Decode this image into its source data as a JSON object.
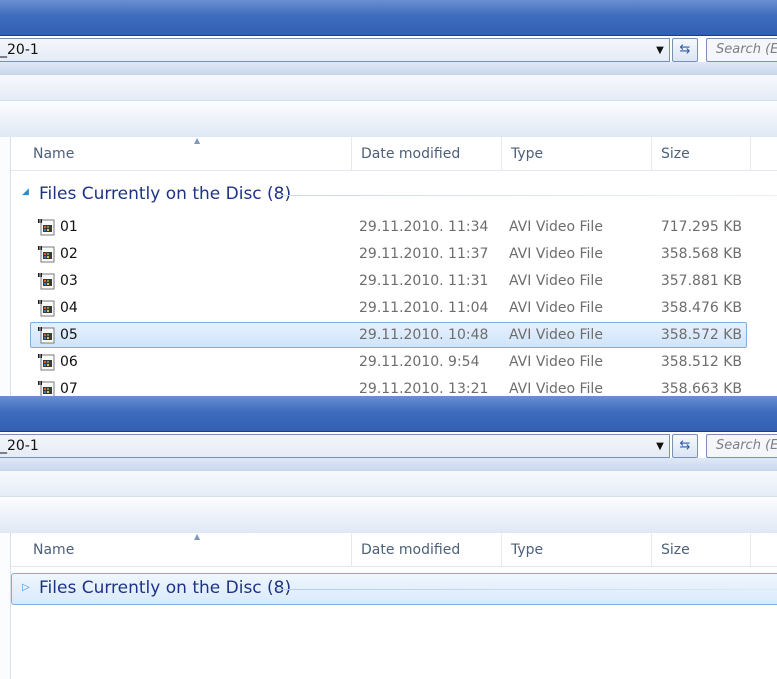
{
  "window": {
    "address": "_20-1",
    "search_placeholder": "Search (E:",
    "dropdown_glyph": "▼",
    "refresh_glyph": "⇆"
  },
  "columns": {
    "name": "Name",
    "date": "Date modified",
    "type": "Type",
    "size": "Size",
    "sort_glyph": "▲"
  },
  "group": {
    "title": "Files Currently on the Disc (8)",
    "expanded_glyph": "◢",
    "collapsed_glyph": "▷"
  },
  "files": [
    {
      "name": "01",
      "date": "29.11.2010. 11:34",
      "type": "AVI Video File",
      "size": "717.295 KB",
      "selected": false
    },
    {
      "name": "02",
      "date": "29.11.2010. 11:37",
      "type": "AVI Video File",
      "size": "358.568 KB",
      "selected": false
    },
    {
      "name": "03",
      "date": "29.11.2010. 11:31",
      "type": "AVI Video File",
      "size": "357.881 KB",
      "selected": false
    },
    {
      "name": "04",
      "date": "29.11.2010. 11:04",
      "type": "AVI Video File",
      "size": "358.476 KB",
      "selected": false
    },
    {
      "name": "05",
      "date": "29.11.2010. 10:48",
      "type": "AVI Video File",
      "size": "358.572 KB",
      "selected": true
    },
    {
      "name": "06",
      "date": "29.11.2010. 9:54",
      "type": "AVI Video File",
      "size": "358.512 KB",
      "selected": false
    },
    {
      "name": "07",
      "date": "29.11.2010. 13:21",
      "type": "AVI Video File",
      "size": "358.663 KB",
      "selected": false
    }
  ],
  "icons": {
    "file": "video-file-icon",
    "dropdown": "chevron-down-icon",
    "refresh": "refresh-icon",
    "group_expanded": "triangle-expanded-icon",
    "group_collapsed": "triangle-collapsed-icon"
  },
  "colors": {
    "selection_border": "#84acdd",
    "group_title": "#1e3287",
    "titlebar": "#3d6bbd"
  }
}
